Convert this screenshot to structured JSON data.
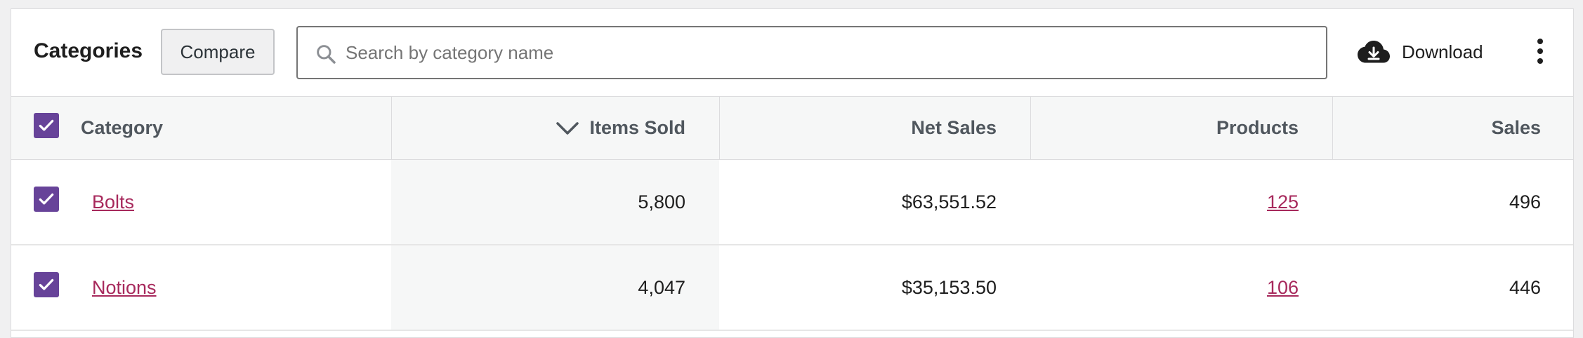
{
  "header": {
    "title": "Categories",
    "compare_label": "Compare",
    "search_placeholder": "Search by category name",
    "search_value": "",
    "download_label": "Download"
  },
  "table": {
    "columns": [
      "Category",
      "Items Sold",
      "Net Sales",
      "Products",
      "Sales"
    ],
    "sorted_column": "Items Sold",
    "sort_direction": "descending",
    "select_all_checked": true,
    "rows": [
      {
        "checked": true,
        "category": "Bolts",
        "items_sold": "5,800",
        "net_sales": "$63,551.52",
        "products": "125",
        "sales": "496"
      },
      {
        "checked": true,
        "category": "Notions",
        "items_sold": "4,047",
        "net_sales": "$35,153.50",
        "products": "106",
        "sales": "446"
      }
    ]
  },
  "colors": {
    "checkbox": "#674399",
    "link": "#a7295c",
    "header_bg": "#f6f7f7"
  },
  "icons": [
    "search-icon",
    "cloud-download-icon",
    "more-vertical-icon",
    "chevron-down-icon",
    "checkmark-icon"
  ]
}
